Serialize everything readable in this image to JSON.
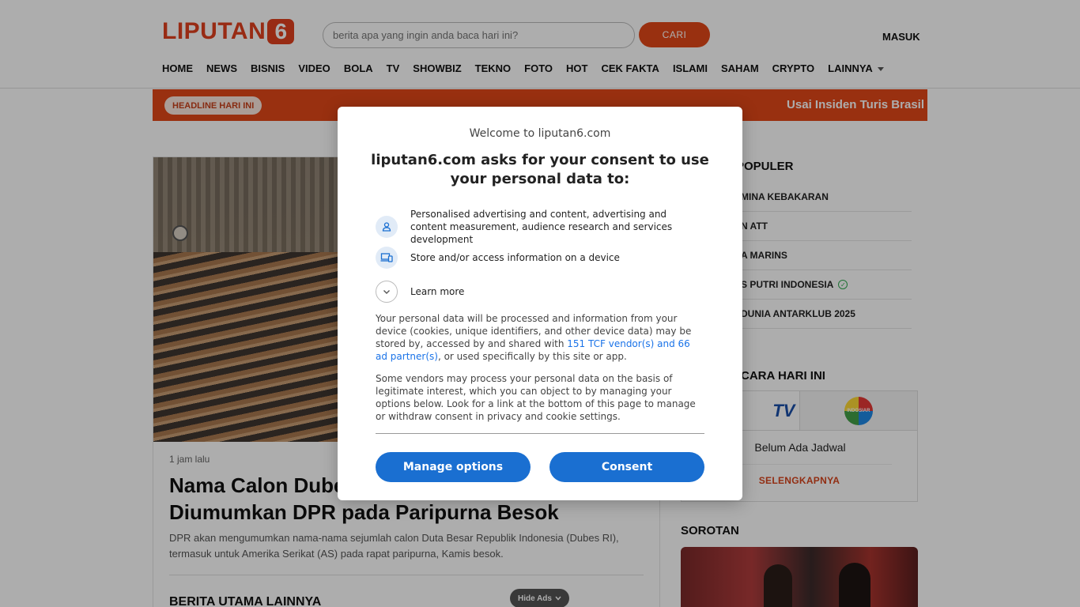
{
  "header": {
    "logo_text": "LIPUTAN",
    "logo_number": "6",
    "search_placeholder": "berita apa yang ingin anda baca hari ini?",
    "search_button": "CARI",
    "login": "MASUK"
  },
  "nav": {
    "items": [
      "HOME",
      "NEWS",
      "BISNIS",
      "VIDEO",
      "BOLA",
      "TV",
      "SHOWBIZ",
      "TEKNO",
      "FOTO",
      "HOT",
      "CEK FAKTA",
      "ISLAMI",
      "SAHAM",
      "CRYPTO",
      "LAINNYA"
    ]
  },
  "headline": {
    "badge": "HEADLINE HARI INI",
    "ticker": "Usai Insiden Turis Brasil"
  },
  "article": {
    "time": "1 jam lalu",
    "title": "Nama Calon Dubes RI untuk AS Bakal Diumumkan DPR pada Paripurna Besok",
    "summary": "DPR akan mengumumkan nama-nama sejumlah calon Duta Besar Republik Indonesia (Dubes RI), termasuk untuk Amerika Serikat (AS) pada rapat paripurna, Kamis besok.",
    "more_heading": "BERITA UTAMA LAINNYA"
  },
  "ads": {
    "hide_label": "Hide Ads"
  },
  "sidebar": {
    "populer_heading": "POPULER",
    "populer_items": [
      "MINA KEBAKARAN",
      "N ATT",
      "A MARINS",
      "S PUTRI INDONESIA",
      "DUNIA ANTARKLUB 2025"
    ],
    "tv_heading": "CARA HARI INI",
    "tv_channel_1": "TV",
    "tv_channel_2": "INDOSIAR",
    "tv_empty": "Belum Ada Jadwal",
    "tv_more": "SELENGKAPNYA",
    "sorotan_heading": "SOROTAN"
  },
  "consent": {
    "welcome": "Welcome to liputan6.com",
    "title": "liputan6.com asks for your consent to use your personal data to:",
    "purpose_1": "Personalised advertising and content, advertising and content measurement, audience research and services development",
    "purpose_2": "Store and/or access information on a device",
    "learn_more": "Learn more",
    "para_1_before": "Your personal data will be processed and information from your device (cookies, unique identifiers, and other device data) may be stored by, accessed by and shared with ",
    "para_1_link": "151 TCF vendor(s) and 66 ad partner(s)",
    "para_1_after": ", or used specifically by this site or app.",
    "para_2": "Some vendors may process your personal data on the basis of legitimate interest, which you can object to by managing your options below. Look for a link at the bottom of this page to manage or withdraw consent in privacy and cookie settings.",
    "manage_button": "Manage options",
    "consent_button": "Consent"
  },
  "colors": {
    "brand": "#e24818",
    "consent_button": "#1a6fd1",
    "link": "#1a73e8"
  }
}
